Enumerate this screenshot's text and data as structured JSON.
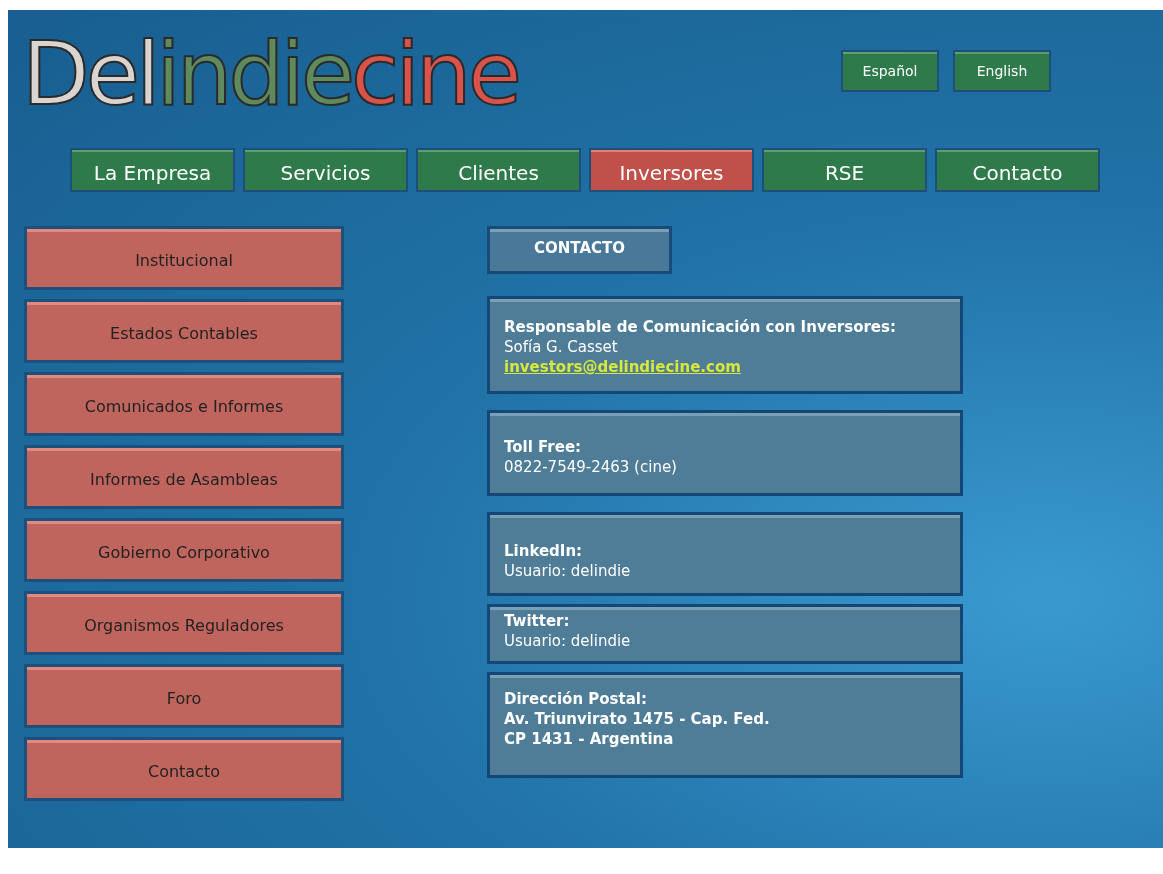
{
  "logo": {
    "parts": [
      {
        "text": "Del",
        "color": "#d9d4d0"
      },
      {
        "text": "indie",
        "color": "#5e8a5e"
      },
      {
        "text": "cine",
        "color": "#d9534a"
      }
    ]
  },
  "languages": [
    {
      "label": "Español",
      "selected": false
    },
    {
      "label": "English",
      "selected": false
    }
  ],
  "nav": [
    {
      "label": "La Empresa",
      "selected": false
    },
    {
      "label": "Servicios",
      "selected": false
    },
    {
      "label": "Clientes",
      "selected": false
    },
    {
      "label": "Inversores",
      "selected": true
    },
    {
      "label": "RSE",
      "selected": false
    },
    {
      "label": "Contacto",
      "selected": false
    }
  ],
  "sidebar": {
    "items": [
      {
        "label": "Institucional"
      },
      {
        "label": "Estados Contables"
      },
      {
        "label": "Comunicados e Informes"
      },
      {
        "label": "Informes de Asambleas"
      },
      {
        "label": "Gobierno Corporativo"
      },
      {
        "label": "Organismos Reguladores"
      },
      {
        "label": "Foro"
      },
      {
        "label": "Contacto"
      }
    ]
  },
  "section_title": "CONTACTO",
  "cards": [
    {
      "lines": [
        {
          "kind": "heading",
          "text": "Responsable de Comunicación  con Inversores:"
        },
        {
          "kind": "text",
          "text": "Sofía G. Casset"
        },
        {
          "kind": "link",
          "text": "investors@delindiecine.com"
        }
      ]
    },
    {
      "lines": [
        {
          "kind": "heading",
          "text": "Toll Free:"
        },
        {
          "kind": "text",
          "text": "0822-7549-2463  (cine)"
        }
      ]
    },
    {
      "lines": [
        {
          "kind": "heading",
          "text": "LinkedIn:"
        },
        {
          "kind": "text",
          "text": "Usuario: delindie"
        }
      ]
    },
    {
      "lines": [
        {
          "kind": "heading",
          "text": "Twitter:"
        },
        {
          "kind": "text",
          "text": "Usuario: delindie"
        }
      ]
    },
    {
      "lines": [
        {
          "kind": "heading",
          "text": "Dirección Postal:"
        },
        {
          "kind": "heading",
          "text": "Av. Triunvirato  1475 - Cap. Fed."
        },
        {
          "kind": "heading",
          "text": "CP 1431  - Argentina"
        }
      ]
    }
  ]
}
